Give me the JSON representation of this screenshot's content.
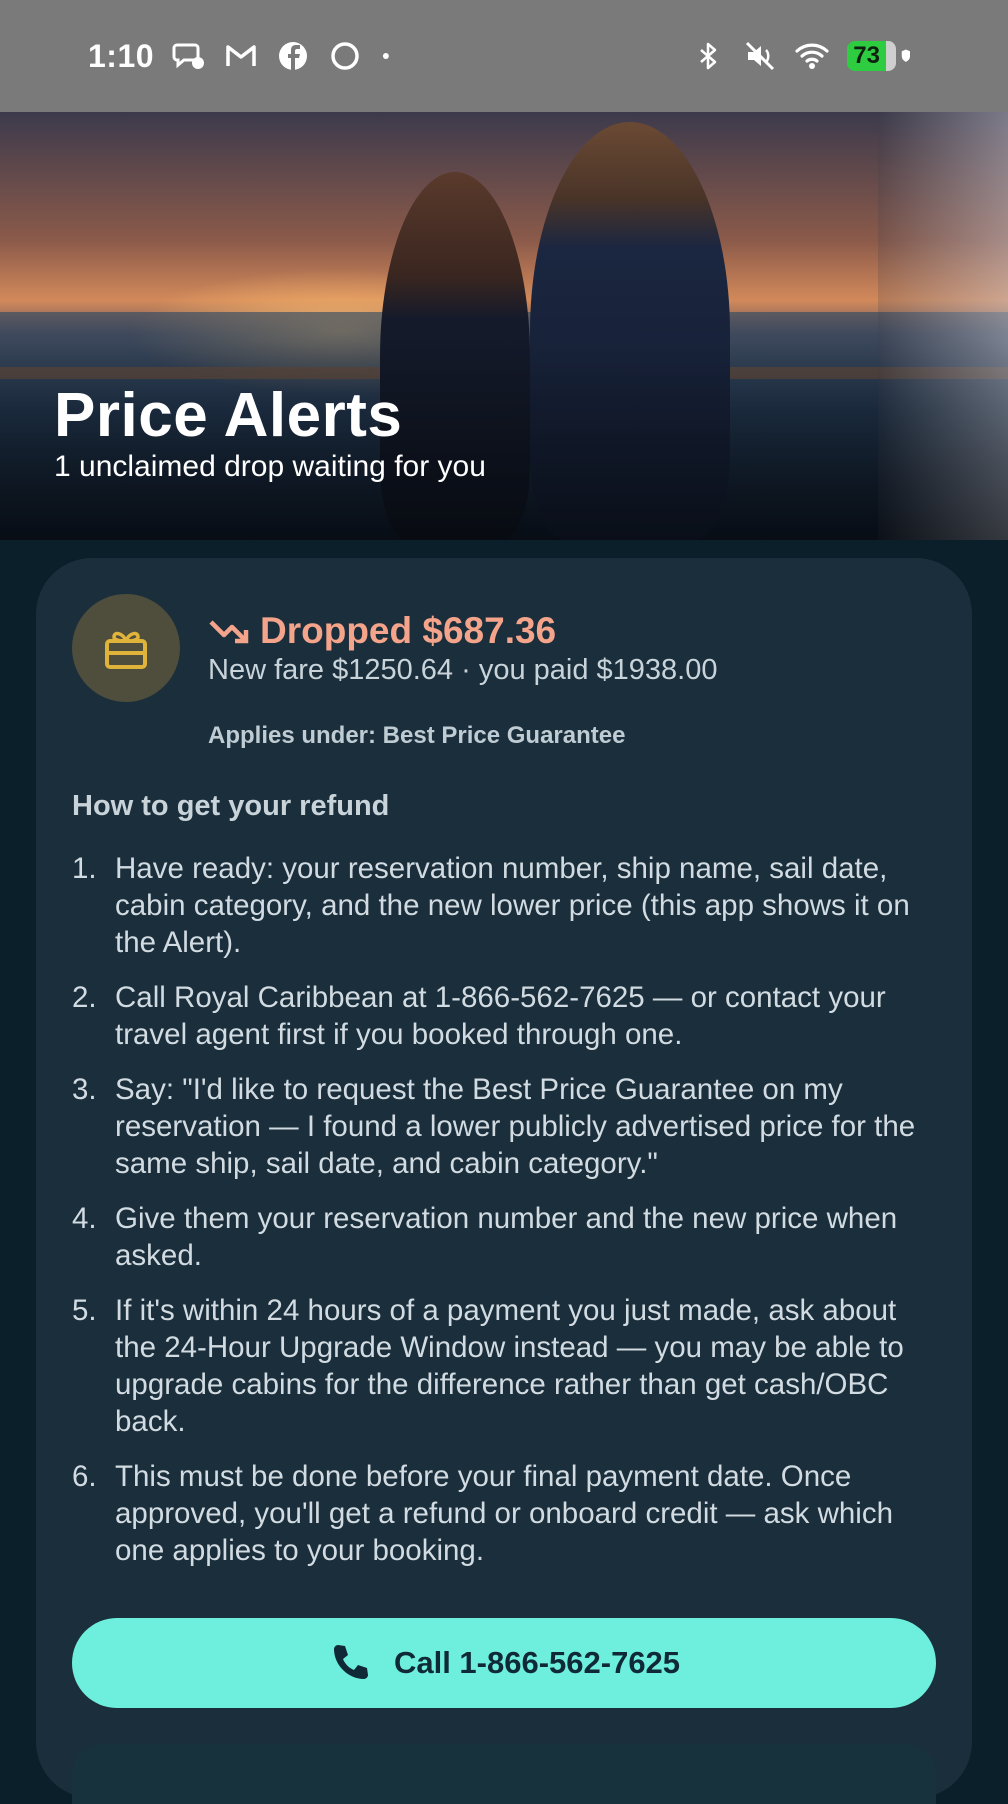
{
  "status_bar": {
    "time": "1:10",
    "left_icons": [
      "messenger-icon",
      "gmail-icon",
      "facebook-icon",
      "circle-app-icon",
      "dot-icon"
    ],
    "right_icons": [
      "bluetooth-icon",
      "mute-icon",
      "wifi-icon",
      "battery-icon"
    ],
    "battery_level": "73"
  },
  "hero": {
    "title": "Price Alerts",
    "subtitle": "1 unclaimed drop waiting for you"
  },
  "alert_card": {
    "icon": "gift-icon",
    "trend_icon": "trending-down-icon",
    "drop_label": "Dropped $687.36",
    "fare_line": "New fare $1250.64 · you paid $1938.00",
    "applies_line": "Applies under: Best Price Guarantee",
    "howto_title": "How to get your refund",
    "steps": [
      {
        "num": "1.",
        "text": "Have ready: your reservation number, ship name, sail date, cabin category, and the new lower price (this app shows it on the Alert)."
      },
      {
        "num": "2.",
        "text": "Call Royal Caribbean at 1-866-562-7625 — or contact your travel agent first if you booked through one."
      },
      {
        "num": "3.",
        "text": "Say: \"I'd like to request the Best Price Guarantee on my reservation — I found a lower publicly advertised price for the same ship, sail date, and cabin category.\""
      },
      {
        "num": "4.",
        "text": "Give them your reservation number and the new price when asked."
      },
      {
        "num": "5.",
        "text": "If it's within 24 hours of a payment you just made, ask about the 24-Hour Upgrade Window instead — you may be able to upgrade cabins for the difference rather than get cash/OBC back."
      },
      {
        "num": "6.",
        "text": "This must be done before your final payment date. Once approved, you'll get a refund or onboard credit — ask which one applies to your booking."
      }
    ],
    "call_button_label": "Call 1-866-562-7625",
    "call_icon": "phone-icon"
  },
  "colors": {
    "background": "#0b1f2a",
    "card": "#1a2e3b",
    "accent_drop": "#f4a48a",
    "button": "#6eeedd",
    "gift_icon": "#e0b43a"
  }
}
